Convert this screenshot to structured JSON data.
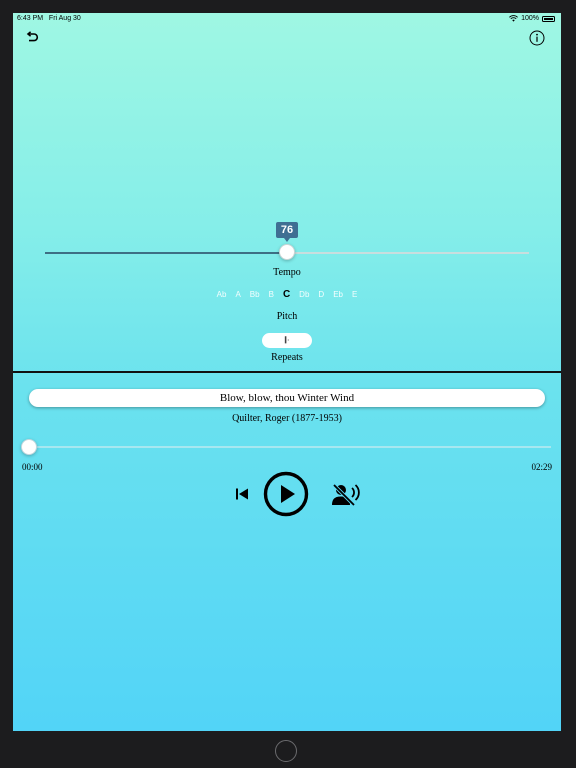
{
  "status_bar": {
    "time": "6:43 PM",
    "date": "Fri Aug 30",
    "battery": "100%"
  },
  "tempo": {
    "value": "76",
    "level_fraction": 0.5,
    "label": "Tempo"
  },
  "pitch": {
    "label": "Pitch",
    "options": [
      "Ab",
      "A",
      "Bb",
      "B",
      "C",
      "Db",
      "D",
      "Eb",
      "E"
    ],
    "selected": "C"
  },
  "repeats": {
    "label": "Repeats",
    "icon": "repeat-sign-icon"
  },
  "track": {
    "title": "Blow, blow, thou Winter Wind",
    "composer": "Quilter, Roger (1877-1953)",
    "elapsed": "00:00",
    "duration": "02:29",
    "progress_fraction": 0.0
  },
  "colors": {
    "accent": "#3f6f93",
    "gradient_top": "#9ff7e3",
    "gradient_bottom": "#52d4f7"
  }
}
